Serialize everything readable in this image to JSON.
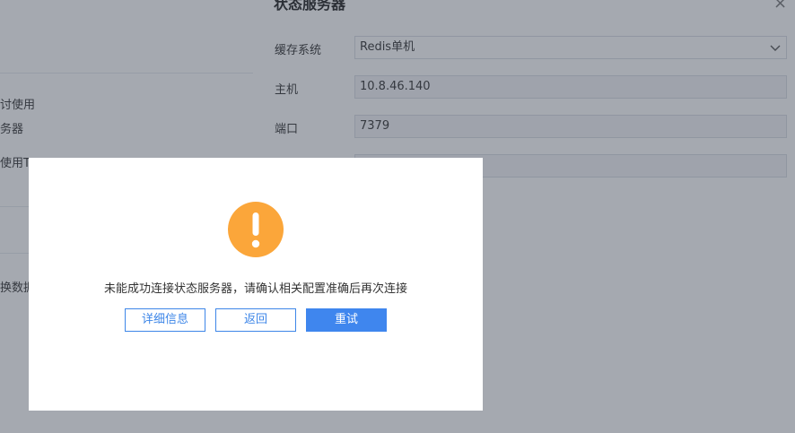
{
  "background": {
    "fragments": [
      "讨使用",
      "务器",
      "使用TC",
      "换数据"
    ]
  },
  "panel": {
    "title": "状态服务器",
    "close_glyph": "×",
    "fields": [
      {
        "label": "缓存系统",
        "value": "Redis单机",
        "type": "select"
      },
      {
        "label": "主机",
        "value": "10.8.46.140",
        "type": "text"
      },
      {
        "label": "端口",
        "value": "7379",
        "type": "text"
      },
      {
        "label": "",
        "value": "",
        "type": "text"
      }
    ]
  },
  "dialog": {
    "icon": "warning-icon",
    "message": "未能成功连接状态服务器，请确认相关配置准确后再次连接",
    "buttons": {
      "details": "详细信息",
      "back": "返回",
      "retry": "重试"
    }
  },
  "colors": {
    "accent": "#3f86ee",
    "warning": "#fba63a",
    "overlay": "rgba(55,64,80,0.45)"
  }
}
